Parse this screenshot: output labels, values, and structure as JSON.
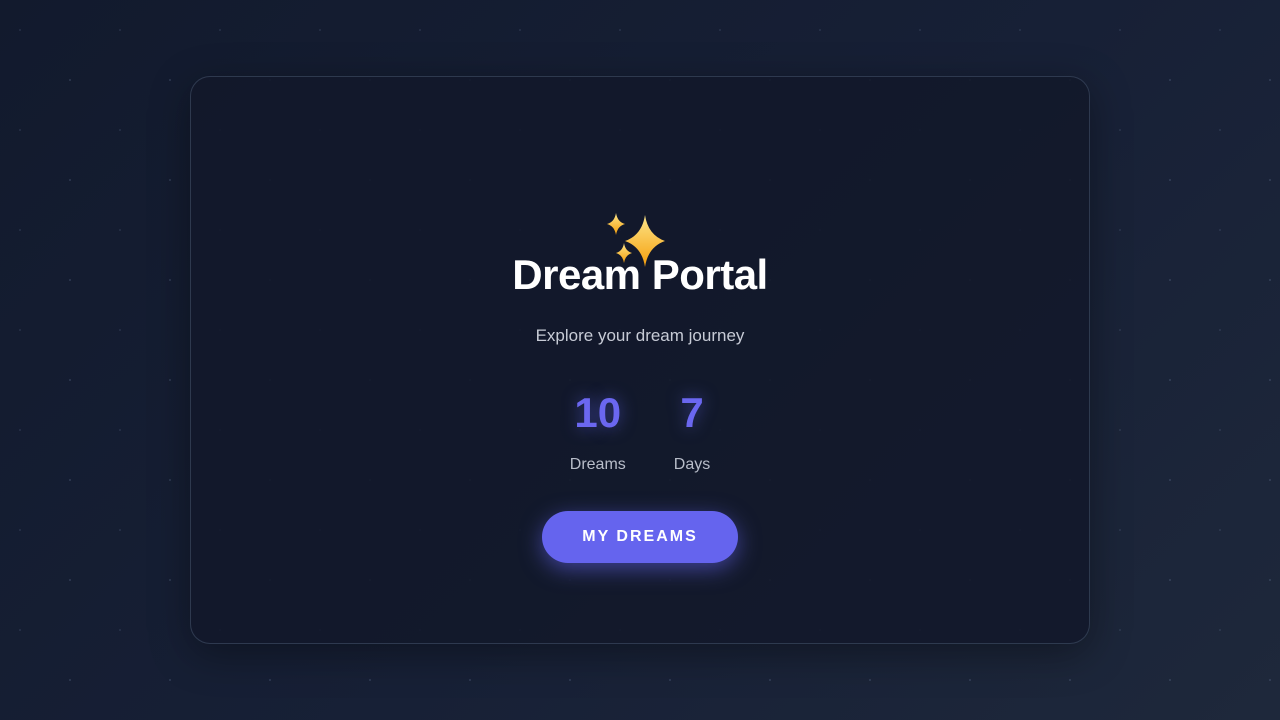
{
  "icon": "sparkles-icon",
  "title": "Dream Portal",
  "subtitle": "Explore your dream journey",
  "stats": [
    {
      "value": "10",
      "label": "Dreams"
    },
    {
      "value": "7",
      "label": "Days"
    }
  ],
  "cta": {
    "label": "MY DREAMS"
  },
  "colors": {
    "accent": "#6366f1",
    "background": "#141b2e",
    "title": "#ffffff",
    "sparkle": "#fcd34d"
  }
}
